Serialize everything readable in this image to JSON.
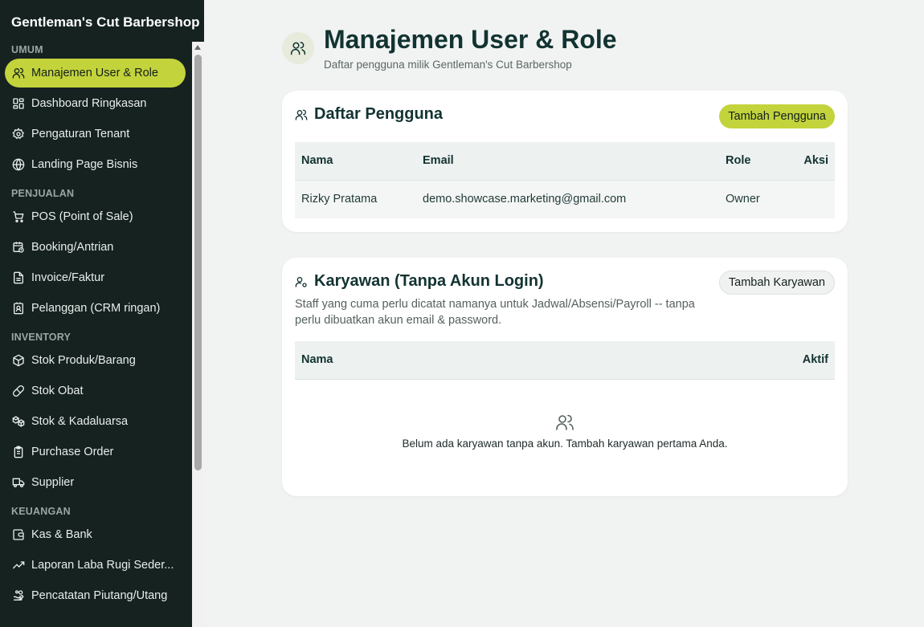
{
  "app": {
    "title": "Gentleman's Cut Barbershop"
  },
  "sidebar": {
    "sections": [
      {
        "label": "UMUM",
        "items": [
          {
            "label": "Manajemen User & Role",
            "icon": "users-icon",
            "active": true
          },
          {
            "label": "Dashboard Ringkasan",
            "icon": "grid-icon"
          },
          {
            "label": "Pengaturan Tenant",
            "icon": "gear-icon"
          },
          {
            "label": "Landing Page Bisnis",
            "icon": "globe-icon"
          }
        ]
      },
      {
        "label": "PENJUALAN",
        "items": [
          {
            "label": "POS (Point of Sale)",
            "icon": "cart-icon"
          },
          {
            "label": "Booking/Antrian",
            "icon": "calendar-clock-icon"
          },
          {
            "label": "Invoice/Faktur",
            "icon": "document-icon"
          },
          {
            "label": "Pelanggan (CRM ringan)",
            "icon": "contact-icon"
          }
        ]
      },
      {
        "label": "INVENTORY",
        "items": [
          {
            "label": "Stok Produk/Barang",
            "icon": "box-icon"
          },
          {
            "label": "Stok Obat",
            "icon": "pill-icon"
          },
          {
            "label": "Stok & Kadaluarsa",
            "icon": "boxes-icon"
          },
          {
            "label": "Purchase Order",
            "icon": "clipboard-icon"
          },
          {
            "label": "Supplier",
            "icon": "truck-icon"
          }
        ]
      },
      {
        "label": "KEUANGAN",
        "items": [
          {
            "label": "Kas & Bank",
            "icon": "wallet-icon"
          },
          {
            "label": "Laporan Laba Rugi Seder...",
            "icon": "trend-up-icon"
          },
          {
            "label": "Pencatatan Piutang/Utang",
            "icon": "hand-coins-icon"
          }
        ]
      }
    ]
  },
  "page": {
    "title": "Manajemen User & Role",
    "subtitle": "Daftar pengguna milik Gentleman's Cut Barbershop"
  },
  "users_card": {
    "title": "Daftar Pengguna",
    "add_button": "Tambah Pengguna",
    "columns": [
      "Nama",
      "Email",
      "Role",
      "Aksi"
    ],
    "rows": [
      {
        "name": "Rizky Pratama",
        "email": "demo.showcase.marketing@gmail.com",
        "role": "Owner",
        "action": ""
      }
    ]
  },
  "staff_card": {
    "title": "Karyawan (Tanpa Akun Login)",
    "add_button": "Tambah Karyawan",
    "description": "Staff yang cuma perlu dicatat namanya untuk Jadwal/Absensi/Payroll -- tanpa perlu dibuatkan akun email & password.",
    "columns": [
      "Nama",
      "Aktif"
    ],
    "empty_text": "Belum ada karyawan tanpa akun. Tambah karyawan pertama Anda."
  },
  "colors": {
    "accent": "#c3d33b",
    "sidebar_bg": "#152220",
    "title": "#123331"
  }
}
